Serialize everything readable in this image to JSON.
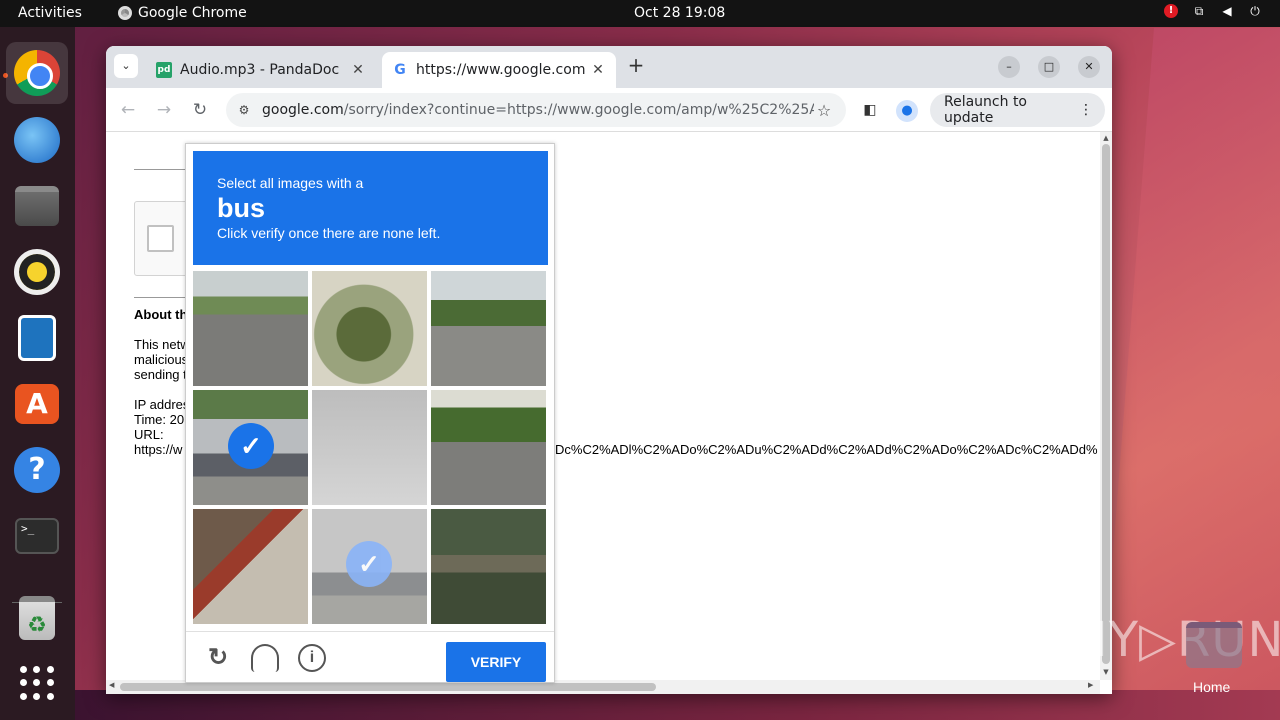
{
  "topbar": {
    "activities": "Activities",
    "app_name": "Google Chrome",
    "clock": "Oct 28  19:08",
    "alert_badge": "!"
  },
  "dock": {
    "items": [
      "google-chrome",
      "thunderbird",
      "files",
      "rhythmbox",
      "libreoffice-writer",
      "ubuntu-software",
      "help",
      "terminal",
      "trash",
      "show-applications"
    ]
  },
  "browser": {
    "tabs": [
      {
        "title": "Audio.mp3 - PandaDoc",
        "favicon": "pd"
      },
      {
        "title": "https://www.google.com",
        "favicon": "G"
      }
    ],
    "url_host": "google.com",
    "url_rest": "/sorry/index?continue=https://www.google.com/amp/w%25C2%25ADe...",
    "relaunch_label": "Relaunch to update"
  },
  "page": {
    "about_heading": "About th",
    "para_lines": [
      "This netw",
      "malicious",
      "sending t"
    ],
    "ip_line": "IP addres",
    "time_line": "Time: 20",
    "url_line": "URL:",
    "url_prefix": "https://w",
    "url_tail": "Dc%C2%ADl%C2%ADo%C2%ADu%C2%ADd%C2%ADd%C2%ADo%C2%ADc%C2%ADd%"
  },
  "captcha": {
    "line1": "Select all images with a",
    "target": "bus",
    "line3": "Click verify once there are none left.",
    "tiles": [
      {
        "scene": "road-cars",
        "selected": false
      },
      {
        "scene": "traffic-light-tree",
        "selected": false
      },
      {
        "scene": "roadside-cars",
        "selected": false
      },
      {
        "scene": "bus",
        "selected": true
      },
      {
        "scene": "foggy-gray",
        "selected": false
      },
      {
        "scene": "road-car",
        "selected": false
      },
      {
        "scene": "roof",
        "selected": false
      },
      {
        "scene": "foggy-bus",
        "selected": true
      },
      {
        "scene": "dark-trees",
        "selected": false
      }
    ],
    "verify_label": "VERIFY"
  },
  "desktop": {
    "watermark": "ANY▷RUN",
    "home_label": "Home"
  }
}
